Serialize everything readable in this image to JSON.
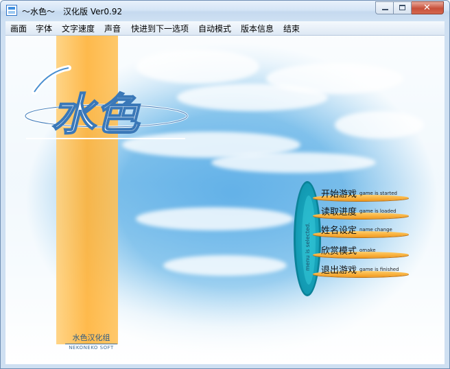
{
  "window": {
    "title": "～水色～　汉化版 Ver0.92",
    "app_icon": "app-icon",
    "controls": {
      "minimize_icon": "minimize-icon",
      "maximize_icon": "maximize-icon",
      "close_glyph": "✕"
    }
  },
  "menubar": {
    "items": [
      "画面",
      "字体",
      "文字速度",
      "声音",
      "快进到下一选项",
      "自动模式",
      "版本信息",
      "结束"
    ]
  },
  "game": {
    "logo_text": "水色",
    "credit": {
      "main": "水色汉化组",
      "sub": "NEKONEKO SOFT"
    },
    "selection_label": "menu is selected.",
    "options": [
      {
        "zh": "开始游戏",
        "en": "game is started"
      },
      {
        "zh": "读取进度",
        "en": "game is loaded"
      },
      {
        "zh": "姓名设定",
        "en": "name change"
      },
      {
        "zh": "欣赏模式",
        "en": "omake"
      },
      {
        "zh": "退出游戏",
        "en": "game is finished"
      }
    ],
    "colors": {
      "accent_orange": "#ffb238",
      "teal": "#0d8ea8",
      "sky": "#7cbde9"
    }
  }
}
